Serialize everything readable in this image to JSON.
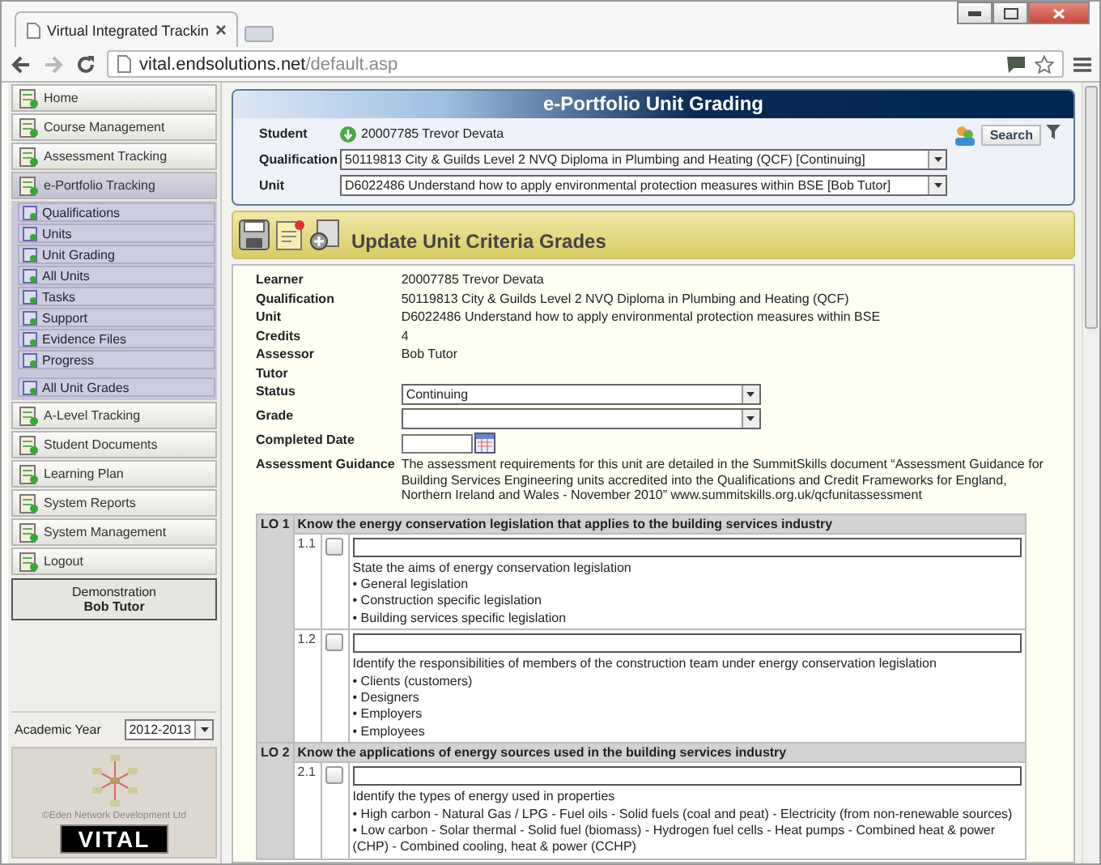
{
  "browser": {
    "tab_title": "Virtual Integrated Trackin",
    "url_host": "vital.endsolutions.net",
    "url_path": "/default.asp"
  },
  "sidebar": {
    "items": [
      {
        "label": "Home",
        "selected": false
      },
      {
        "label": "Course Management",
        "selected": false
      },
      {
        "label": "Assessment Tracking",
        "selected": false
      },
      {
        "label": "e-Portfolio Tracking",
        "selected": true,
        "children": [
          {
            "label": "Qualifications"
          },
          {
            "label": "Units"
          },
          {
            "label": "Unit Grading"
          },
          {
            "label": "All Units"
          },
          {
            "label": "Tasks"
          },
          {
            "label": "Support"
          },
          {
            "label": "Evidence Files"
          },
          {
            "label": "Progress"
          }
        ],
        "extra": [
          {
            "label": "All Unit Grades"
          }
        ]
      },
      {
        "label": "A-Level Tracking",
        "selected": false
      },
      {
        "label": "Student Documents",
        "selected": false
      },
      {
        "label": "Learning Plan",
        "selected": false
      },
      {
        "label": "System Reports",
        "selected": false
      },
      {
        "label": "System Management",
        "selected": false
      },
      {
        "label": "Logout",
        "selected": false
      }
    ],
    "user": [
      "Demonstration",
      "Bob Tutor"
    ],
    "academic_year": {
      "label": "Academic Year",
      "value": "2012-2013"
    },
    "logo": {
      "copyright": "©Eden Network Development Ltd",
      "brand": "VITAL"
    }
  },
  "header": {
    "title": "e-Portfolio Unit Grading",
    "search_button": "Search",
    "fields": [
      {
        "label": "Student",
        "value": "20007785 Trevor Devata",
        "kind": "text"
      },
      {
        "label": "Qualification",
        "value": "50119813 City & Guilds Level 2 NVQ Diploma in Plumbing and Heating (QCF) [Continuing]",
        "kind": "select"
      },
      {
        "label": "Unit",
        "value": "D6022486 Understand how to apply environmental protection measures within BSE [Bob Tutor]",
        "kind": "select"
      }
    ]
  },
  "section_title": "Update Unit Criteria Grades",
  "details": [
    {
      "label": "Learner",
      "value": "20007785 Trevor Devata",
      "kind": "text"
    },
    {
      "label": "Qualification",
      "value": "50119813 City & Guilds Level 2 NVQ Diploma in Plumbing and Heating (QCF)",
      "kind": "text"
    },
    {
      "label": "Unit",
      "value": "D6022486 Understand how to apply environmental protection measures within BSE",
      "kind": "text"
    },
    {
      "label": "Credits",
      "value": "4",
      "kind": "text"
    },
    {
      "label": "Assessor",
      "value": "Bob Tutor",
      "kind": "text"
    },
    {
      "label": "Tutor",
      "kind": "text"
    },
    {
      "label": "Status",
      "value": "Continuing",
      "kind": "select"
    },
    {
      "label": "Grade",
      "kind": "select"
    },
    {
      "label": "Completed Date",
      "kind": "date"
    },
    {
      "label": "Assessment Guidance",
      "value": "The assessment requirements for this unit are detailed in the SummitSkills document “Assessment Guidance for Building Services Engineering units accredited into the Qualifications and Credit Frameworks for England, Northern Ireland and Wales - November 2010” www.summitskills.org.uk/qcfunitassessment",
      "kind": "text"
    }
  ],
  "outcomes": [
    {
      "code": "LO 1",
      "title": "Know the energy conservation legislation that applies to the building services industry",
      "criteria": [
        {
          "code": "1.1",
          "checked": false,
          "description": "State the aims of energy conservation legislation",
          "bullets": [
            "• General legislation",
            "• Construction specific legislation",
            "• Building services specific legislation"
          ]
        },
        {
          "code": "1.2",
          "checked": false,
          "description": "Identify the responsibilities of members of the construction team under energy conservation legislation",
          "bullets": [
            "• Clients (customers)",
            "• Designers",
            "• Employers",
            "• Employees"
          ]
        }
      ]
    },
    {
      "code": "LO 2",
      "title": "Know the applications of energy sources used in the building services industry",
      "criteria": [
        {
          "code": "2.1",
          "checked": false,
          "description": "Identify the types of energy used in properties",
          "bullets": [
            "• High carbon - Natural Gas / LPG - Fuel oils - Solid fuels (coal and peat) - Electricity (from non-renewable sources)",
            "• Low carbon - Solar thermal - Solid fuel (biomass) - Hydrogen fuel cells - Heat pumps - Combined heat & power (CHP) - Combined cooling, heat & power (CCHP)"
          ]
        }
      ]
    }
  ]
}
